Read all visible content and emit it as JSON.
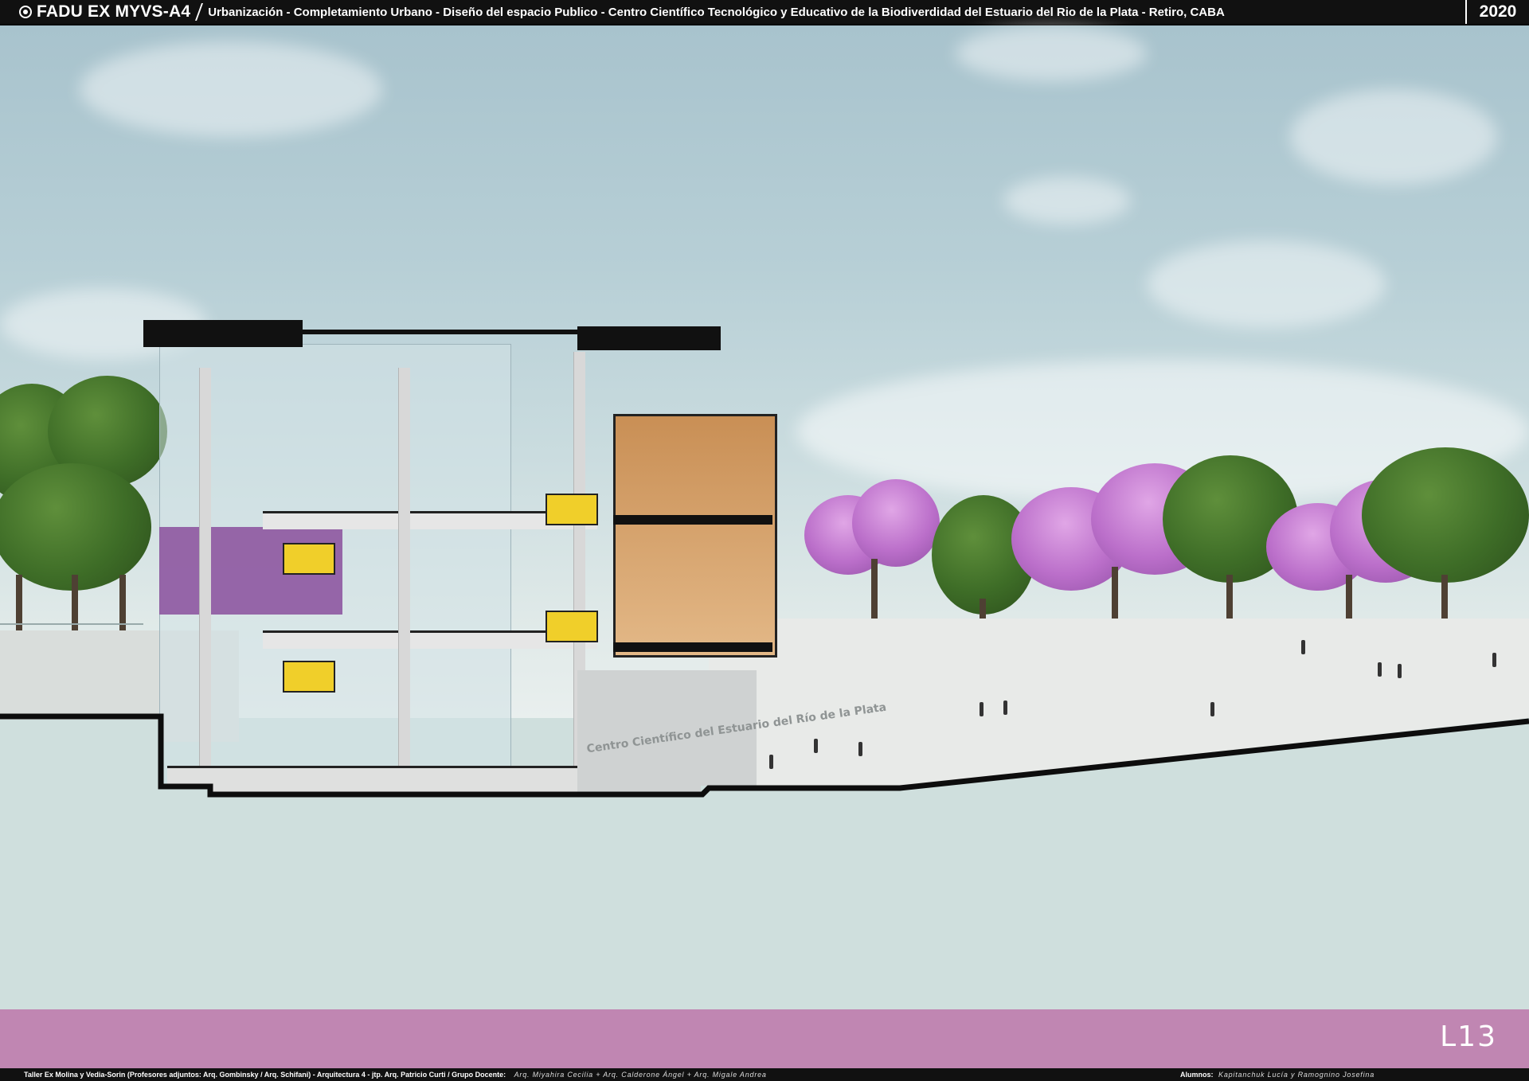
{
  "header": {
    "brand": "FADU EX MYVS-A4",
    "subtitle": "Urbanización - Completamiento Urbano - Diseño del espacio Publico - Centro Científico Tecnológico y Educativo de la Biodiverdidad del Estuario del Rio de la Plata   - Retiro, CABA",
    "year": "2020",
    "brand_icon": "globe-icon"
  },
  "render": {
    "facade_sign": "Centro Científico del Estuario del Río de la Plata",
    "colors": {
      "sky": "#b7cfd6",
      "section_fill": "#cfdfdd",
      "accent_yellow": "#f0cf2a",
      "accent_purple": "#8a4f9c",
      "jacaranda": "#bb6fca"
    }
  },
  "band": {
    "color": "#c086b2",
    "sheet_number": "L13"
  },
  "footer": {
    "taller": "Taller Ex Molina y Vedia-Sorin (Profesores adjuntos:  Arq. Gombinsky / Arq. Schifani) - Arquitectura 4 - jtp. Arq. Patricio Curti / Grupo Docente:",
    "docentes": "Arq. Miyahira Cecilia  +  Arq. Calderone Ángel  +  Arq. Migale Andrea",
    "alumnos_label": "Alumnos:",
    "alumnos": "Kapitanchuk Lucía  y  Ramognino Josefina"
  }
}
